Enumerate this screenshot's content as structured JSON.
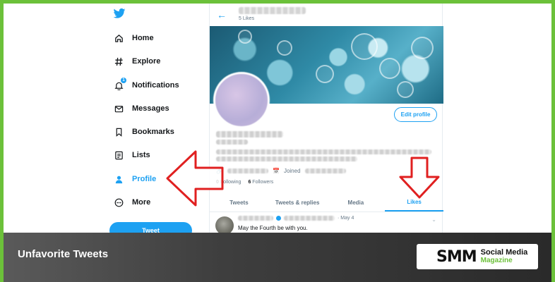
{
  "sidebar": {
    "items": [
      {
        "label": "Home",
        "icon": "home-icon"
      },
      {
        "label": "Explore",
        "icon": "hashtag-icon"
      },
      {
        "label": "Notifications",
        "icon": "bell-icon"
      },
      {
        "label": "Messages",
        "icon": "envelope-icon"
      },
      {
        "label": "Bookmarks",
        "icon": "bookmark-icon"
      },
      {
        "label": "Lists",
        "icon": "list-icon"
      },
      {
        "label": "Profile",
        "icon": "person-icon"
      },
      {
        "label": "More",
        "icon": "more-circle-icon"
      }
    ],
    "tweet_button": "Tweet",
    "notification_badge": "1"
  },
  "profile": {
    "likes_count": "5 Likes",
    "edit_button": "Edit profile",
    "joined_label": "Joined",
    "following_count": "0",
    "following_label": "Following",
    "followers_count": "6",
    "followers_label": "Followers"
  },
  "tabs": [
    "Tweets",
    "Tweets & replies",
    "Media",
    "Likes"
  ],
  "active_tab": "Likes",
  "tweet": {
    "date": "· May 4",
    "text": "May the Fourth be with you."
  },
  "overlay": {
    "title": "Unfavorite Tweets",
    "logo_letters": "SMM",
    "logo_line1": "Social Media",
    "logo_line2": "Magazine"
  },
  "colors": {
    "twitter_blue": "#1da1f2",
    "frame_green": "#6cc13a",
    "arrow_red": "#e02020"
  }
}
